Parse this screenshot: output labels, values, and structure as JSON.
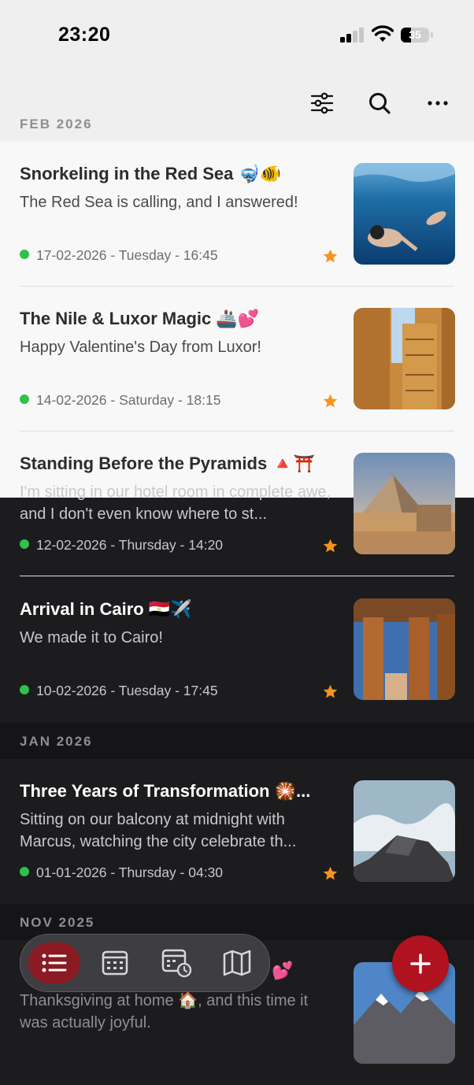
{
  "status_bar": {
    "time": "23:20",
    "battery": "35",
    "battery_level": 0.35
  },
  "toolbar": {
    "icons": [
      "sliders-icon",
      "search-icon",
      "more-icon"
    ]
  },
  "sections": [
    {
      "title": "FEB 2026",
      "entries": [
        {
          "title": "Snorkeling in the Red Sea 🤿🐠",
          "snippet": "The Red Sea is calling, and I answered!",
          "date": "17-02-2026 - Tuesday - 16:45",
          "starred": true
        },
        {
          "title": "The Nile & Luxor Magic 🚢💕",
          "snippet": "Happy Valentine's Day from Luxor!",
          "date": "14-02-2026 - Saturday - 18:15",
          "starred": true
        },
        {
          "title": "Standing Before the Pyramids 🔺⛩️",
          "snippet": "I'm sitting in our hotel room in complete awe, and I don't even know where to st...",
          "date": "12-02-2026 - Thursday - 14:20",
          "starred": true
        },
        {
          "title": "Arrival in Cairo 🇪🇬✈️",
          "snippet": "We made it to Cairo!",
          "date": "10-02-2026 - Tuesday - 17:45",
          "starred": true
        }
      ]
    },
    {
      "title": "JAN 2026",
      "entries": [
        {
          "title": "Three Years of Transformation 🎇...",
          "snippet": "Sitting on our balcony at midnight with Marcus, watching the city celebrate th...",
          "date": "01-01-2026 - Thursday - 04:30",
          "starred": true
        }
      ]
    },
    {
      "title": "NOV 2025",
      "entries": [
        {
          "title": "💕",
          "snippet": "Thanksgiving at home 🏠, and this time it was actually joyful.",
          "date": "",
          "starred": false
        }
      ]
    }
  ],
  "tabbar": {
    "tabs": [
      "list-icon",
      "calendar-icon",
      "calendar-clock-icon",
      "map-icon"
    ],
    "active": "list-icon"
  },
  "fab": {
    "label": "+"
  },
  "colors": {
    "accent": "#b0121f",
    "star": "#f7931e",
    "dot": "#30c14a"
  }
}
